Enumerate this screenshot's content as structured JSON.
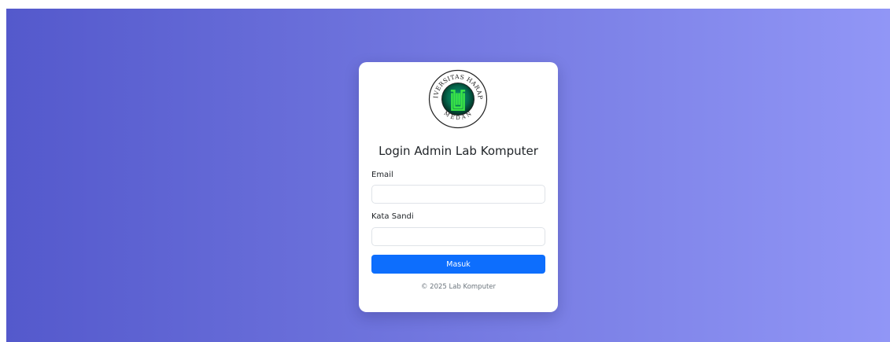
{
  "login": {
    "logo": {
      "ring_text_top": "UNIVERSITAS HARAPAN",
      "ring_text_bottom": "MEDAN"
    },
    "title": "Login Admin Lab Komputer",
    "email_label": "Email",
    "email_value": "",
    "password_label": "Kata Sandi",
    "password_value": "",
    "submit_label": "Masuk",
    "footer": "© 2025 Lab Komputer"
  },
  "colors": {
    "gradient_start": "#5459cc",
    "gradient_end": "#9196f6",
    "button": "#0d6efd",
    "logo_green": "#38e840"
  }
}
